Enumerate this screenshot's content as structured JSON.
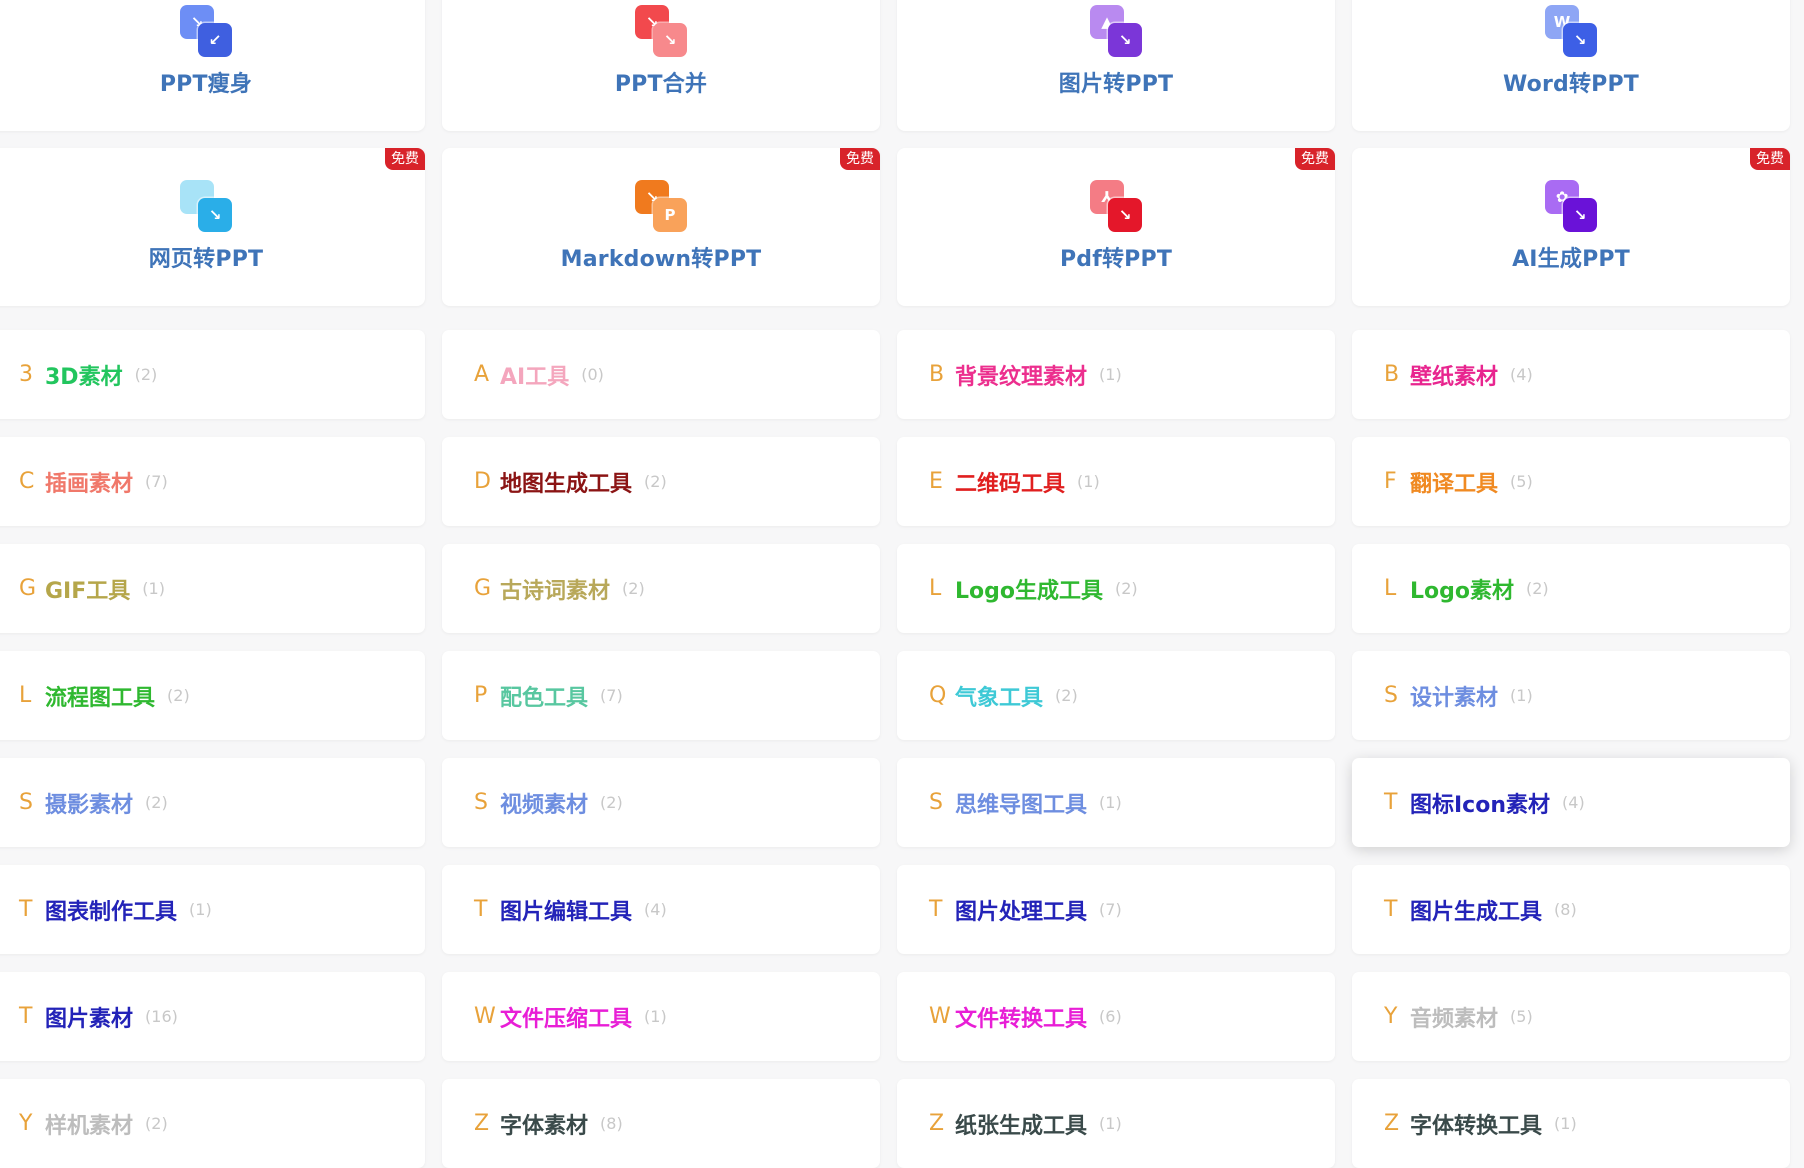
{
  "tools": [
    {
      "label": "PPT瘦身",
      "free": "",
      "icon": "compress-icon",
      "colors": [
        "#6d8ef5",
        "#3f5fe0"
      ],
      "glyphs": [
        "↘",
        "↙"
      ]
    },
    {
      "label": "PPT合并",
      "free": "",
      "icon": "merge-icon",
      "colors": [
        "#f2494d",
        "#f7898c"
      ],
      "glyphs": [
        "↘",
        "↘"
      ]
    },
    {
      "label": "图片转PPT",
      "free": "",
      "icon": "image-convert-icon",
      "colors": [
        "#b98af0",
        "#7b36d8"
      ],
      "glyphs": [
        "▲",
        "↘"
      ]
    },
    {
      "label": "Word转PPT",
      "free": "",
      "icon": "word-convert-icon",
      "colors": [
        "#8ea6f5",
        "#3d5fe6"
      ],
      "glyphs": [
        "W",
        "↘"
      ]
    },
    {
      "label": "网页转PPT",
      "free": "免费",
      "icon": "webpage-convert-icon",
      "colors": [
        "#a8e3f7",
        "#2aaee8"
      ],
      "glyphs": [
        "</>",
        "↘"
      ]
    },
    {
      "label": "Markdown转PPT",
      "free": "免费",
      "icon": "markdown-convert-icon",
      "colors": [
        "#f07a1e",
        "#f9a25a"
      ],
      "glyphs": [
        "↘",
        "P"
      ]
    },
    {
      "label": "Pdf转PPT",
      "free": "免费",
      "icon": "pdf-convert-icon",
      "colors": [
        "#f47c85",
        "#e4172a"
      ],
      "glyphs": [
        "⅄",
        "↘"
      ]
    },
    {
      "label": "AI生成PPT",
      "free": "免费",
      "icon": "ai-generate-icon",
      "colors": [
        "#a96bf3",
        "#6a12d8"
      ],
      "glyphs": [
        "✿",
        "↘"
      ]
    }
  ],
  "categories": [
    {
      "letter": "3",
      "name": "3D素材",
      "count": "(2)",
      "color": "#22c55e"
    },
    {
      "letter": "A",
      "name": "AI工具",
      "count": "(0)",
      "color": "#f4a6bd"
    },
    {
      "letter": "B",
      "name": "背景纹理素材",
      "count": "(1)",
      "color": "#ec2f8e"
    },
    {
      "letter": "B",
      "name": "壁纸素材",
      "count": "(4)",
      "color": "#e8258f"
    },
    {
      "letter": "C",
      "name": "插画素材",
      "count": "(7)",
      "color": "#f0786a"
    },
    {
      "letter": "D",
      "name": "地图生成工具",
      "count": "(2)",
      "color": "#8b1414"
    },
    {
      "letter": "E",
      "name": "二维码工具",
      "count": "(1)",
      "color": "#e01f1f"
    },
    {
      "letter": "F",
      "name": "翻译工具",
      "count": "(5)",
      "color": "#f08a22"
    },
    {
      "letter": "G",
      "name": "GIF工具",
      "count": "(1)",
      "color": "#b5a64a"
    },
    {
      "letter": "G",
      "name": "古诗词素材",
      "count": "(2)",
      "color": "#b8a85a"
    },
    {
      "letter": "L",
      "name": "Logo生成工具",
      "count": "(2)",
      "color": "#2fb830"
    },
    {
      "letter": "L",
      "name": "Logo素材",
      "count": "(2)",
      "color": "#2fb830"
    },
    {
      "letter": "L",
      "name": "流程图工具",
      "count": "(2)",
      "color": "#2fb830"
    },
    {
      "letter": "P",
      "name": "配色工具",
      "count": "(7)",
      "color": "#58c7a0"
    },
    {
      "letter": "Q",
      "name": "气象工具",
      "count": "(2)",
      "color": "#3ec9d6"
    },
    {
      "letter": "S",
      "name": "设计素材",
      "count": "(1)",
      "color": "#6e8ee0"
    },
    {
      "letter": "S",
      "name": "摄影素材",
      "count": "(2)",
      "color": "#6e8ee0"
    },
    {
      "letter": "S",
      "name": "视频素材",
      "count": "(2)",
      "color": "#6e8ee0"
    },
    {
      "letter": "S",
      "name": "思维导图工具",
      "count": "(1)",
      "color": "#6e8ee0"
    },
    {
      "letter": "T",
      "name": "图标Icon素材",
      "count": "(4)",
      "color": "#2323b8"
    },
    {
      "letter": "T",
      "name": "图表制作工具",
      "count": "(1)",
      "color": "#2323b8"
    },
    {
      "letter": "T",
      "name": "图片编辑工具",
      "count": "(4)",
      "color": "#2323b8"
    },
    {
      "letter": "T",
      "name": "图片处理工具",
      "count": "(7)",
      "color": "#2323b8"
    },
    {
      "letter": "T",
      "name": "图片生成工具",
      "count": "(8)",
      "color": "#2323b8"
    },
    {
      "letter": "T",
      "name": "图片素材",
      "count": "(16)",
      "color": "#2323b8"
    },
    {
      "letter": "W",
      "name": "文件压缩工具",
      "count": "(1)",
      "color": "#e81ed6"
    },
    {
      "letter": "W",
      "name": "文件转换工具",
      "count": "(6)",
      "color": "#e81ed6"
    },
    {
      "letter": "Y",
      "name": "音频素材",
      "count": "(5)",
      "color": "#bdbdbd"
    },
    {
      "letter": "Y",
      "name": "样机素材",
      "count": "(2)",
      "color": "#bdbdbd"
    },
    {
      "letter": "Z",
      "name": "字体素材",
      "count": "(8)",
      "color": "#3a4a4a"
    },
    {
      "letter": "Z",
      "name": "纸张生成工具",
      "count": "(1)",
      "color": "#3a4a4a"
    },
    {
      "letter": "Z",
      "name": "字体转换工具",
      "count": "(1)",
      "color": "#3a4a4a"
    }
  ],
  "active_category": "图标Icon素材"
}
